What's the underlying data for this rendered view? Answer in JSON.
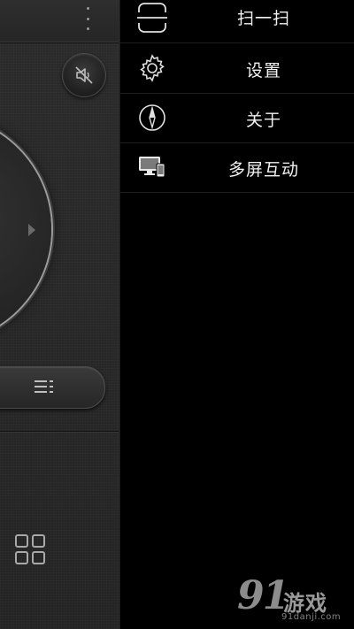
{
  "remote": {
    "more_icon": "more-vertical-icon",
    "mute_icon": "volume-mute-icon",
    "dpad_icon": "chevron-right-icon",
    "menu_icon": "menu-lines-icon",
    "grid_icon": "grid-apps-icon"
  },
  "drawer": {
    "items": [
      {
        "label": "扫一扫",
        "icon": "scan-icon"
      },
      {
        "label": "设置",
        "icon": "gear-icon"
      },
      {
        "label": "关于",
        "icon": "compass-icon"
      },
      {
        "label": "多屏互动",
        "icon": "multi-screen-icon"
      }
    ]
  },
  "watermark": {
    "brand": "91",
    "name": "游戏",
    "domain": "91danji.com"
  },
  "colors": {
    "drawer_bg": "#000000",
    "panel_bg": "#262626",
    "text": "#f2f2f2",
    "ring": "#9c9c9c"
  }
}
